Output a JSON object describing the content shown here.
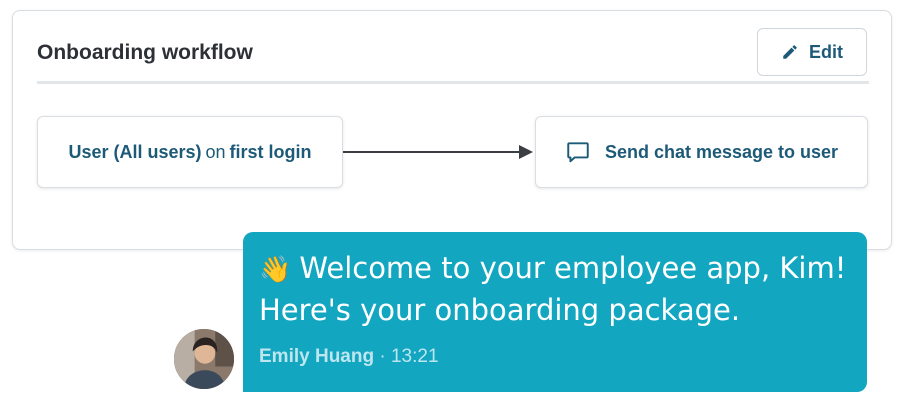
{
  "workflow": {
    "title": "Onboarding workflow",
    "edit_label": "Edit",
    "trigger": {
      "subject": "User (All users)",
      "connector": "on",
      "event": "first login"
    },
    "action": {
      "label": "Send chat message to user",
      "icon": "chat-bubble-icon"
    }
  },
  "message": {
    "emoji": "👋",
    "text": "Welcome to your employee app, Kim! Here's your onboarding package.",
    "sender": "Emily Huang",
    "separator": "·",
    "time": "13:21"
  },
  "colors": {
    "accent_text": "#1d5a78",
    "bubble": "#12a6c1",
    "border": "#d8dde2"
  }
}
